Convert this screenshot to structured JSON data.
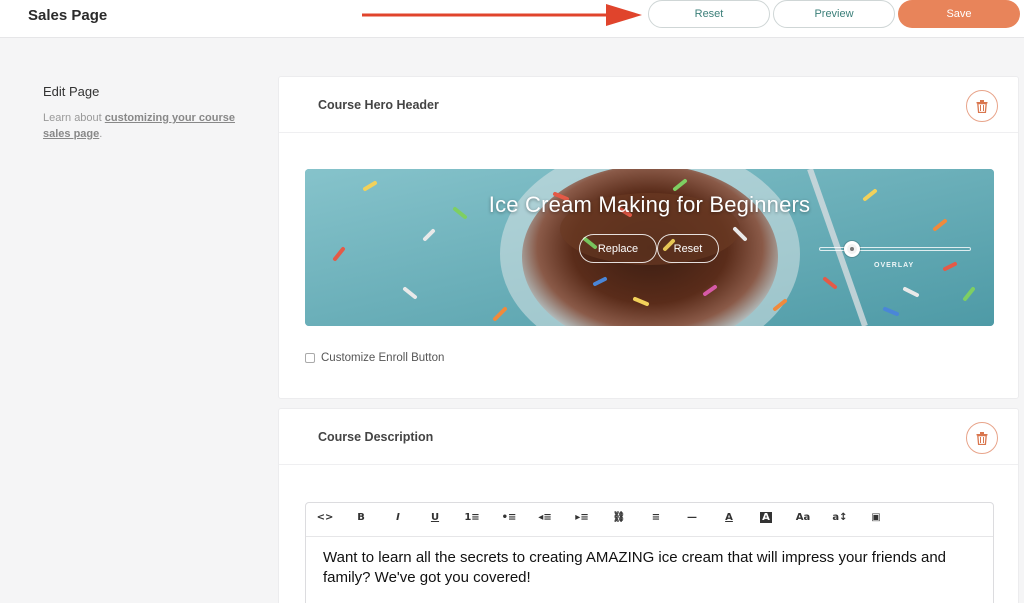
{
  "header": {
    "title": "Sales Page",
    "reset_label": "Reset",
    "preview_label": "Preview",
    "save_label": "Save",
    "accent_color": "#e8845a"
  },
  "aside": {
    "title": "Edit Page",
    "text_prefix": "Learn about ",
    "link_text": "customizing your course sales page",
    "text_suffix": "."
  },
  "hero_section": {
    "title": "Course Hero Header",
    "hero_title": "Ice Cream Making for Beginners",
    "replace_label": "Replace",
    "reset_label": "Reset",
    "overlay_label": "OVERLAY",
    "overlay_level": 0.22,
    "enroll_label": "Customize Enroll Button",
    "enroll_checked": false
  },
  "description_section": {
    "title": "Course Description",
    "toolbar_icons": [
      "code-icon",
      "bold-icon",
      "italic-icon",
      "underline-icon",
      "ordered-list-icon",
      "bullet-list-icon",
      "outdent-icon",
      "indent-icon",
      "link-icon",
      "align-left-icon",
      "horizontal-rule-icon",
      "text-color-icon",
      "highlight-icon",
      "font-size-icon",
      "line-height-icon",
      "image-icon"
    ],
    "toolbar_glyphs": [
      "<>",
      "B",
      "I",
      "U",
      "1≡",
      "•≡",
      "◂≡",
      "▸≡",
      "⛓",
      "≡",
      "—",
      "A",
      "A",
      "Aa",
      "a↕",
      "▣"
    ],
    "body_text": "Want to learn all the secrets to creating AMAZING ice cream that will impress your friends and family? We've got you covered!"
  }
}
